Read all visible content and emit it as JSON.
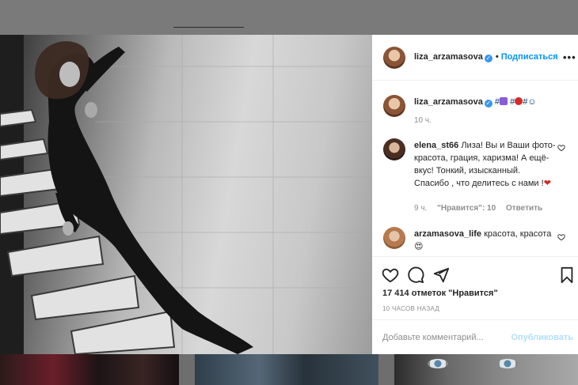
{
  "post": {
    "author": "liza_arzamasova",
    "separator": "•",
    "follow_label": "Подписаться",
    "more_label": "•••"
  },
  "caption": {
    "author": "liza_arzamasova",
    "hash1": "#",
    "hash2": "#",
    "hash3": "#",
    "smiley": "☺",
    "time": "10 ч."
  },
  "comments": [
    {
      "user": "elena_st66",
      "text": "Лиза! Вы и Ваши фото- красота, грация, харизма! А ещё- вкус! Тонкий, изысканный. Спасибо , что делитесь с нами !",
      "emoji": "❤",
      "time": "9 ч.",
      "likes": "\"Нравится\": 10",
      "reply": "Ответить"
    },
    {
      "user": "arzamasova_life",
      "text": "красота, красота",
      "emoji": "😍"
    }
  ],
  "likes_text": "17 414 отметок \"Нравится\"",
  "time_ago": "10 ЧАСОВ НАЗАД",
  "comment_input": {
    "placeholder": "Добавьте комментарий...",
    "post_label": "Опубликовать"
  },
  "icons": {
    "like": "heart-icon",
    "comment": "comment-icon",
    "share": "share-icon",
    "save": "bookmark-icon",
    "more": "more-options-icon",
    "verified": "verified-badge-icon"
  },
  "colors": {
    "link": "#0095f6",
    "verified": "#3897f0",
    "emoji_heart": "#d62a2a"
  }
}
